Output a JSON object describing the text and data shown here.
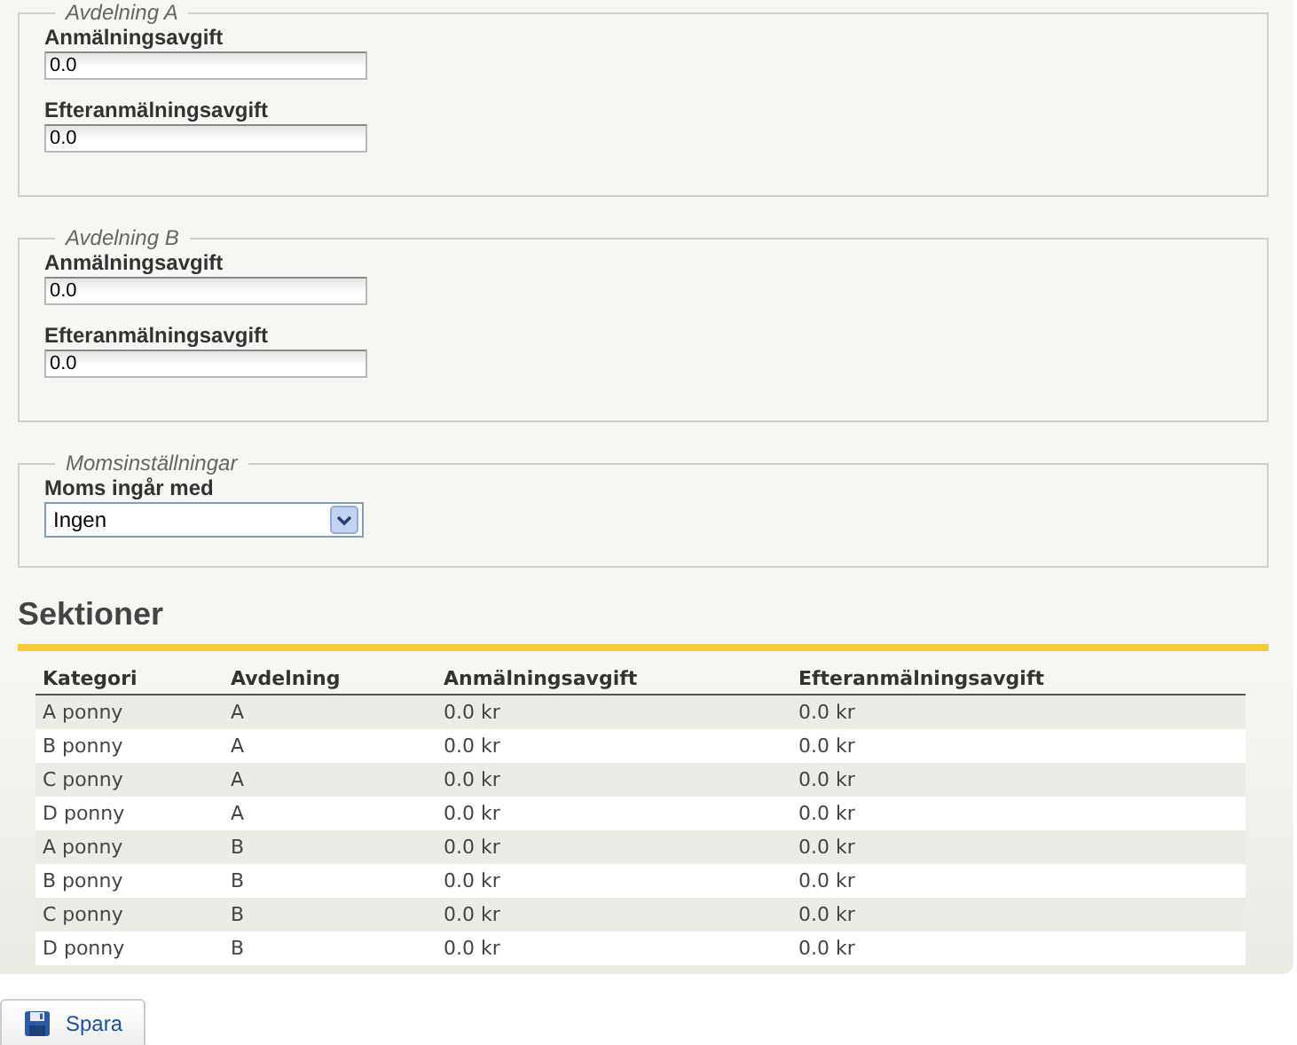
{
  "fieldsets": [
    {
      "legend": "Avdelning A",
      "fields": [
        {
          "label": "Anmälningsavgift",
          "value": "0.0"
        },
        {
          "label": "Efteranmälningsavgift",
          "value": "0.0"
        }
      ]
    },
    {
      "legend": "Avdelning B",
      "fields": [
        {
          "label": "Anmälningsavgift",
          "value": "0.0"
        },
        {
          "label": "Efteranmälningsavgift",
          "value": "0.0"
        }
      ]
    }
  ],
  "vat": {
    "legend": "Momsinställningar",
    "label": "Moms ingår med",
    "value": "Ingen"
  },
  "sections": {
    "title": "Sektioner",
    "columns": [
      "Kategori",
      "Avdelning",
      "Anmälningsavgift",
      "Efteranmälningsavgift"
    ],
    "rows": [
      [
        "A ponny",
        "A",
        "0.0 kr",
        "0.0 kr"
      ],
      [
        "B ponny",
        "A",
        "0.0 kr",
        "0.0 kr"
      ],
      [
        "C ponny",
        "A",
        "0.0 kr",
        "0.0 kr"
      ],
      [
        "D ponny",
        "A",
        "0.0 kr",
        "0.0 kr"
      ],
      [
        "A ponny",
        "B",
        "0.0 kr",
        "0.0 kr"
      ],
      [
        "B ponny",
        "B",
        "0.0 kr",
        "0.0 kr"
      ],
      [
        "C ponny",
        "B",
        "0.0 kr",
        "0.0 kr"
      ],
      [
        "D ponny",
        "B",
        "0.0 kr",
        "0.0 kr"
      ]
    ]
  },
  "save_button": "Spara"
}
